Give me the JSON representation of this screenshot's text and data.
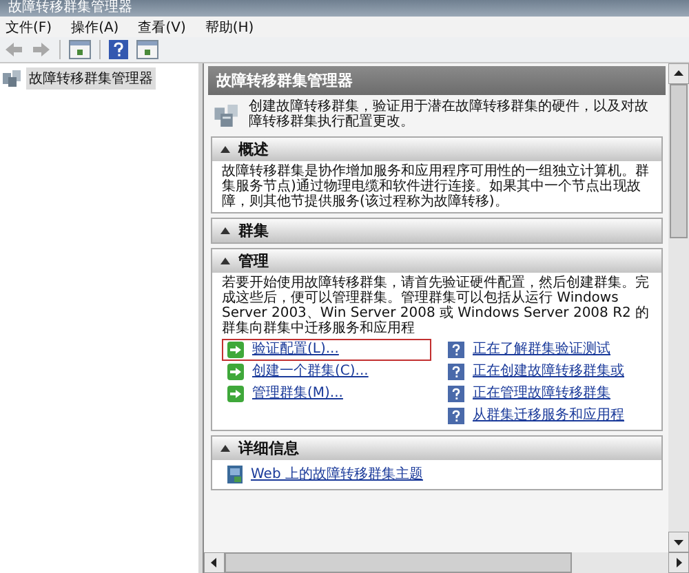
{
  "window": {
    "title": "故障转移群集管理器"
  },
  "menu": [
    "文件(F)",
    "操作(A)",
    "查看(V)",
    "帮助(H)"
  ],
  "tree": {
    "items": [
      {
        "label": "故障转移群集管理器",
        "selected": true
      }
    ]
  },
  "panel": {
    "title": "故障转移群集管理器",
    "description": "创建故障转移群集，验证用于潜在故障转移群集的硬件，以及对故障转移群集执行配置更改。",
    "sections": [
      {
        "title": "概述",
        "text": "故障转移群集是协作增加服务和应用程序可用性的一组独立计算机。群集服务节点)通过物理电缆和软件进行连接。如果其中一个节点出现故障，则其他节提供服务(该过程称为故障转移)。"
      },
      {
        "title": "群集"
      },
      {
        "title": "管理",
        "text": "若要开始使用故障转移群集，请首先验证硬件配置，然后创建群集。完成这些后，便可以管理群集。管理群集可以包括从运行 Windows Server 2003、Win Server 2008 或 Windows Server 2008 R2 的群集向群集中迁移服务和应用程",
        "actions": [
          {
            "label": "验证配置(L)...",
            "highlighted": true
          },
          {
            "label": "创建一个群集(C)...",
            "highlighted": false
          },
          {
            "label": "管理群集(M)...",
            "highlighted": false
          }
        ],
        "topics": [
          "正在了解群集验证测试",
          "正在创建故障转移群集或",
          "正在管理故障转移群集",
          "从群集迁移服务和应用程"
        ]
      },
      {
        "title": "详细信息",
        "links": [
          "Web 上的故障转移群集主题"
        ]
      }
    ]
  }
}
